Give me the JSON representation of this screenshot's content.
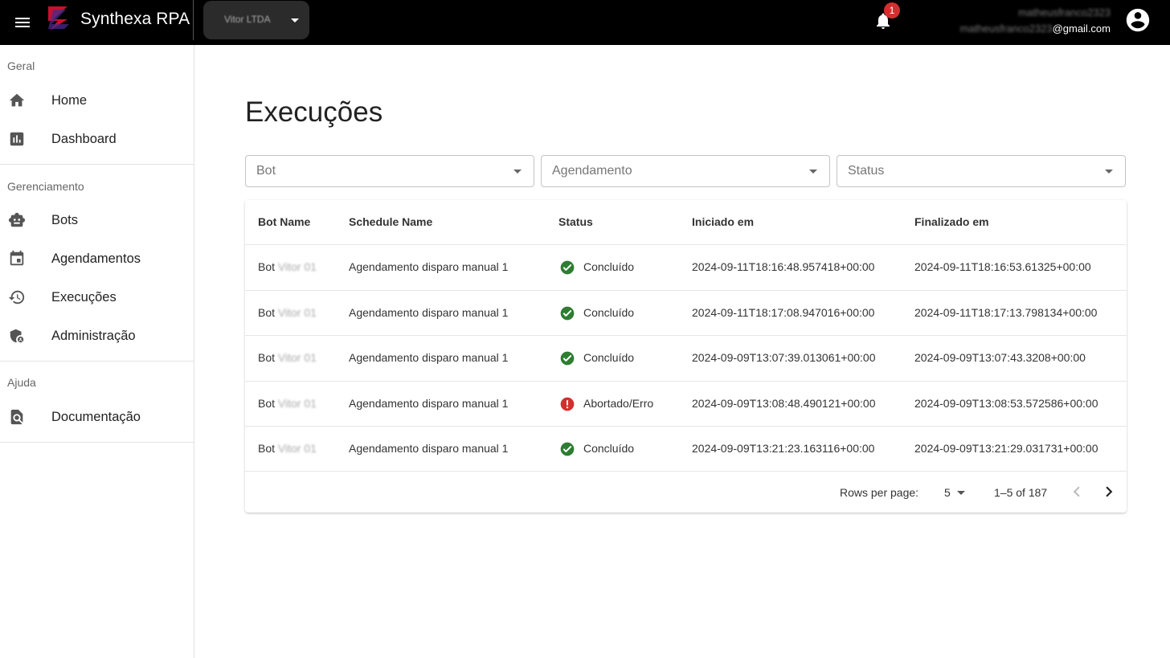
{
  "header": {
    "app_title": "Synthexa RPA",
    "company": "Vitor LTDA",
    "notification_count": "1",
    "user_line1": "matheusfranco2323",
    "user_line2_blur": "matheusfranco2323",
    "user_line2_domain": "@gmail.com"
  },
  "sidebar": {
    "sections": [
      {
        "title": "Geral",
        "items": [
          {
            "label": "Home",
            "icon": "home-icon"
          },
          {
            "label": "Dashboard",
            "icon": "bar-chart-icon"
          }
        ]
      },
      {
        "title": "Gerenciamento",
        "items": [
          {
            "label": "Bots",
            "icon": "robot-icon"
          },
          {
            "label": "Agendamentos",
            "icon": "calendar-icon"
          },
          {
            "label": "Execuções",
            "icon": "history-icon"
          },
          {
            "label": "Administração",
            "icon": "admin-shield-icon"
          }
        ]
      },
      {
        "title": "Ajuda",
        "items": [
          {
            "label": "Documentação",
            "icon": "doc-search-icon"
          }
        ]
      }
    ]
  },
  "main": {
    "title": "Execuções",
    "filters": [
      "Bot",
      "Agendamento",
      "Status"
    ],
    "table": {
      "headers": [
        "Bot Name",
        "Schedule Name",
        "Status",
        "Iniciado em",
        "Finalizado em"
      ],
      "rows": [
        {
          "bot_prefix": "Bot",
          "bot_blur": "Vitor 01",
          "schedule": "Agendamento disparo manual 1",
          "status": "Concluído",
          "status_type": "success",
          "start": "2024-09-11T18:16:48.957418+00:00",
          "end": "2024-09-11T18:16:53.61325+00:00"
        },
        {
          "bot_prefix": "Bot",
          "bot_blur": "Vitor 01",
          "schedule": "Agendamento disparo manual 1",
          "status": "Concluído",
          "status_type": "success",
          "start": "2024-09-11T18:17:08.947016+00:00",
          "end": "2024-09-11T18:17:13.798134+00:00"
        },
        {
          "bot_prefix": "Bot",
          "bot_blur": "Vitor 01",
          "schedule": "Agendamento disparo manual 1",
          "status": "Concluído",
          "status_type": "success",
          "start": "2024-09-09T13:07:39.013061+00:00",
          "end": "2024-09-09T13:07:43.3208+00:00"
        },
        {
          "bot_prefix": "Bot",
          "bot_blur": "Vitor 01",
          "schedule": "Agendamento disparo manual 1",
          "status": "Abortado/Erro",
          "status_type": "error",
          "start": "2024-09-09T13:08:48.490121+00:00",
          "end": "2024-09-09T13:08:53.572586+00:00"
        },
        {
          "bot_prefix": "Bot",
          "bot_blur": "Vitor 01",
          "schedule": "Agendamento disparo manual 1",
          "status": "Concluído",
          "status_type": "success",
          "start": "2024-09-09T13:21:23.163116+00:00",
          "end": "2024-09-09T13:21:29.031731+00:00"
        }
      ]
    },
    "pagination": {
      "rows_per_page_label": "Rows per page:",
      "rows_per_page": "5",
      "range": "1–5 of 187"
    }
  },
  "colors": {
    "topbar": "#000000",
    "success": "#2e7d32",
    "error": "#d32f2f",
    "badge": "#d32f2f"
  }
}
